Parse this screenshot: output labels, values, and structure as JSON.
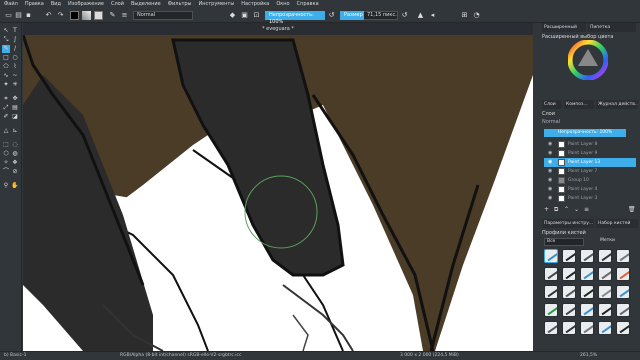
{
  "menu": [
    "Файл",
    "Правка",
    "Вид",
    "Изображение",
    "Слой",
    "Выделение",
    "Фильтры",
    "Инструменты",
    "Настройка",
    "Окно",
    "Справка"
  ],
  "toolbar": {
    "blend_mode": "Normal",
    "opacity_label": "Непрозрачность: 100%",
    "size_label": "Размер",
    "size_value": "71,15 пикс."
  },
  "document_tab": "* eveguara *",
  "dock": {
    "color_selector_tab": "Расширенный",
    "color_selector_tab2": "Пипетка",
    "color_selector_title": "Расширенный выбор цвета",
    "tabs": [
      "Слои",
      "Композ...",
      "Журнал действ..."
    ],
    "layers_title": "Слои",
    "blend_mode": "Normal",
    "opacity": "Непрозрачность: 100%",
    "layers": [
      {
        "name": "Paint Layer 8",
        "active": false
      },
      {
        "name": "Paint Layer 9",
        "active": false
      },
      {
        "name": "Paint Layer 13",
        "active": true
      },
      {
        "name": "Paint Layer 7",
        "active": false
      },
      {
        "name": "Group 10",
        "active": false
      },
      {
        "name": "Paint Layer 4",
        "active": false
      },
      {
        "name": "Paint Layer 3",
        "active": false
      }
    ],
    "tool_options_tab": "Параметры инстру...",
    "brush_presets_tab": "Набор кистей",
    "brush_profile_title": "Профили кистей",
    "brush_filter": "Все",
    "brush_tag_label": "Метки"
  },
  "status": {
    "left": "b) Basic-1",
    "center": "RGB/Alpha (8-bit int/channel)  sRGB-elle-V2-srgbtrc.icc",
    "right": "3 000 x 2 000 (224,5 MiB)",
    "zoom": "261,5%"
  },
  "colors": {
    "accent": "#3daee9",
    "ui_bg": "#31363b",
    "hair": "#4a3c26",
    "sleeve": "#2b2b2b"
  }
}
